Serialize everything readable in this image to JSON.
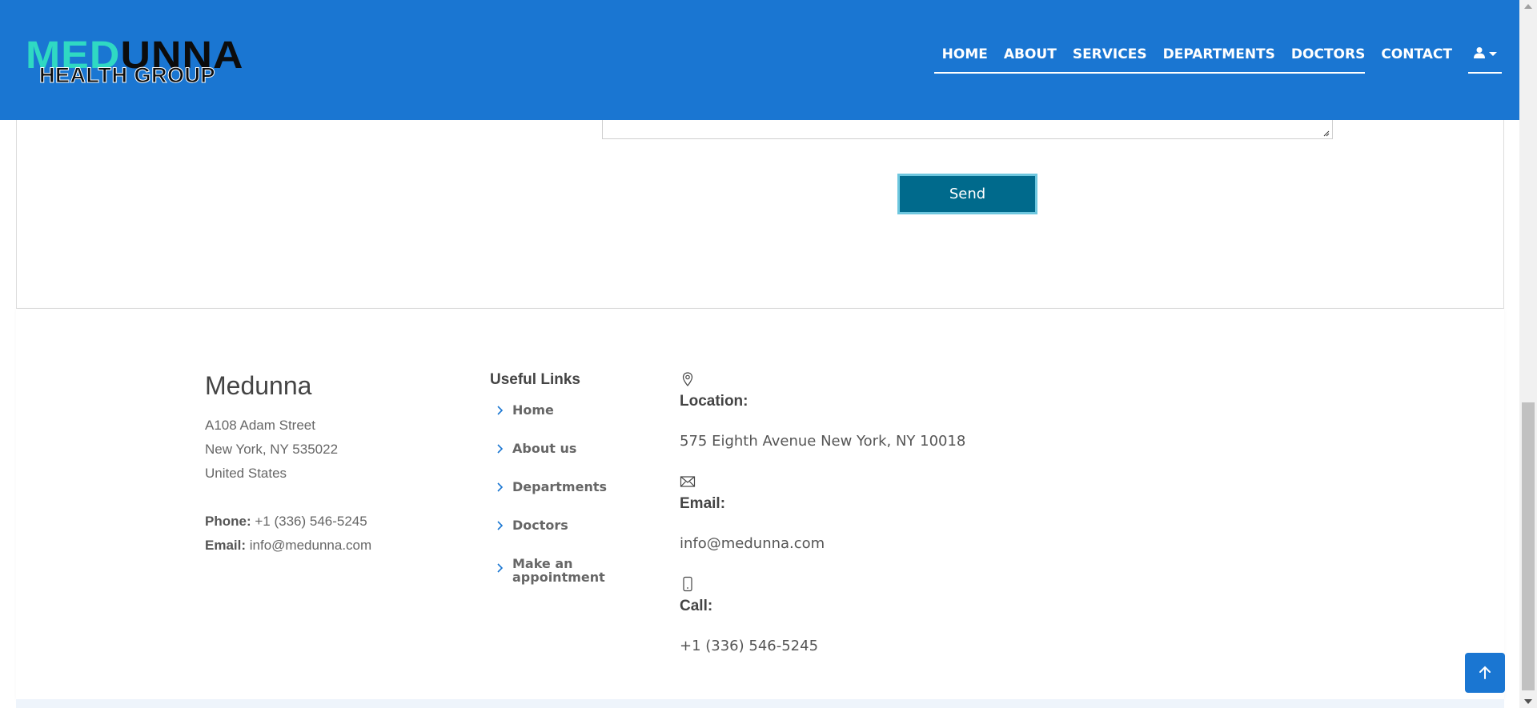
{
  "header": {
    "logo": {
      "line1_a": "MED",
      "line1_b": "UNNA",
      "line2": "HEALTH GROUP"
    },
    "nav": [
      "HOME",
      "ABOUT",
      "SERVICES",
      "DEPARTMENTS",
      "DOCTORS",
      "CONTACT"
    ]
  },
  "form": {
    "send_label": "Send"
  },
  "footer": {
    "brand": "Medunna",
    "address": [
      "A108 Adam Street",
      "New York, NY 535022",
      "United States"
    ],
    "phone_label": "Phone:",
    "phone": "+1 (336) 546-5245",
    "email_label": "Email:",
    "email": "info@medunna.com",
    "links_title": "Useful Links",
    "links": [
      "Home",
      "About us",
      "Departments",
      "Doctors",
      "Make an appointment"
    ],
    "info": [
      {
        "icon": "location-icon",
        "label": "Location:",
        "value": "575 Eighth Avenue New York, NY 10018"
      },
      {
        "icon": "envelope-icon",
        "label": "Email:",
        "value": "info@medunna.com"
      },
      {
        "icon": "phone-icon",
        "label": "Call:",
        "value": "+1 (336) 546-5245"
      }
    ]
  },
  "colors": {
    "header": "#1a76d2",
    "send_button": "#006a8c",
    "logo_accent": "#2fd9c3"
  }
}
